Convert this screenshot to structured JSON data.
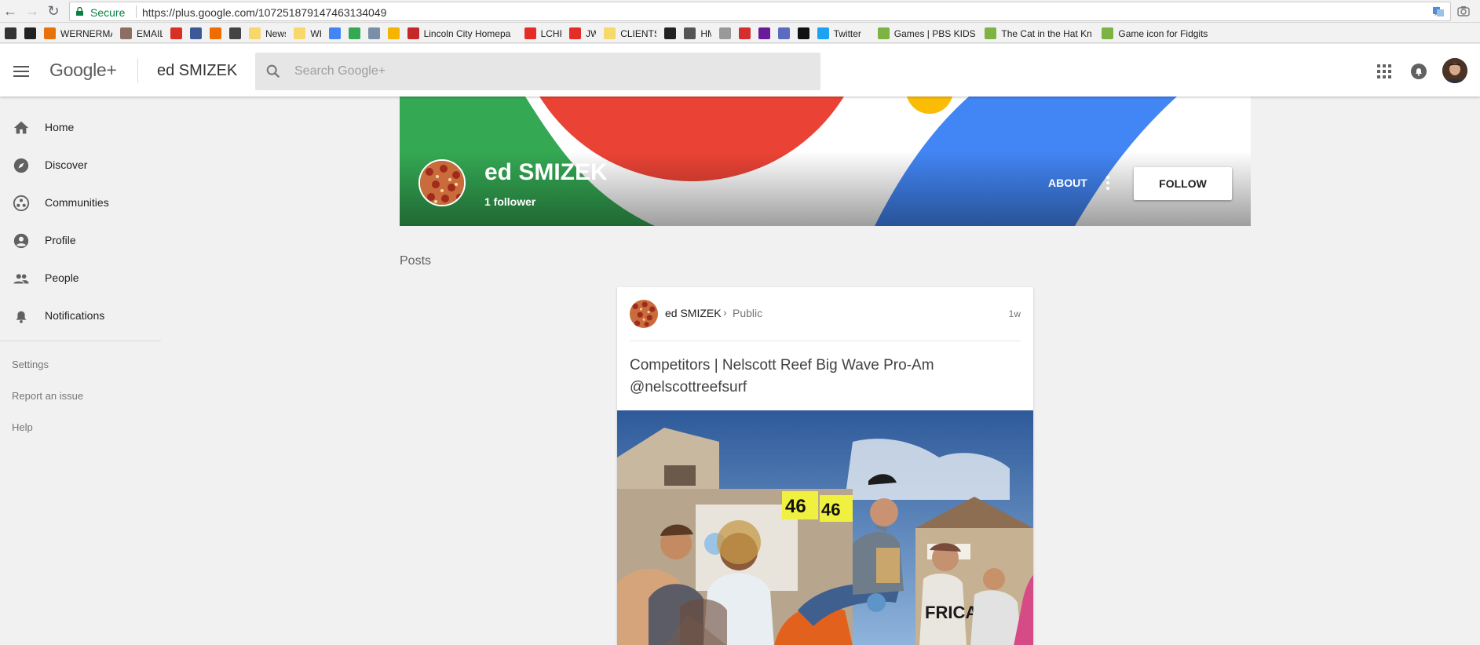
{
  "browser": {
    "secure_label": "Secure",
    "url": "https://plus.google.com/107251879147463134049",
    "bookmarks": [
      {
        "label": "",
        "color": "#333333"
      },
      {
        "label": "",
        "color": "#222222"
      },
      {
        "label": "WERNERMAIL",
        "color": "#e8710a"
      },
      {
        "label": "EMAIL",
        "color": "#8d6e63"
      },
      {
        "label": "",
        "color": "#d93025"
      },
      {
        "label": "",
        "color": "#3b5998"
      },
      {
        "label": "",
        "color": "#ef6c00"
      },
      {
        "label": "",
        "color": "#444444"
      },
      {
        "label": "News",
        "color": "#f6d86b"
      },
      {
        "label": "WH",
        "color": "#f6d86b"
      },
      {
        "label": "",
        "color": "#4285f4"
      },
      {
        "label": "",
        "color": "#34a853"
      },
      {
        "label": "",
        "color": "#7b8ea8"
      },
      {
        "label": "",
        "color": "#f4b400"
      },
      {
        "label": "Lincoln City Homepa",
        "color": "#c62828"
      },
      {
        "label": "LCHP",
        "color": "#e52d27"
      },
      {
        "label": "JW",
        "color": "#e52d27"
      },
      {
        "label": "CLIENTS",
        "color": "#f6d86b"
      },
      {
        "label": "",
        "color": "#222222"
      },
      {
        "label": "HM",
        "color": "#555555"
      },
      {
        "label": "",
        "color": "#999999"
      },
      {
        "label": "",
        "color": "#d32f2f"
      },
      {
        "label": "",
        "color": "#6a1b9a"
      },
      {
        "label": "",
        "color": "#5c6bc0"
      },
      {
        "label": "",
        "color": "#111111"
      },
      {
        "label": "Twitter",
        "color": "#1da1f2"
      },
      {
        "label": "Games | PBS KIDS",
        "color": "#7cb342"
      },
      {
        "label": "The Cat in the Hat Kn",
        "color": "#7cb342"
      },
      {
        "label": "Game icon for Fidgits",
        "color": "#7cb342"
      }
    ]
  },
  "header": {
    "logo": "Google+",
    "profile_name": "ed SMIZEK",
    "search_placeholder": "Search Google+"
  },
  "nav": {
    "items": [
      {
        "label": "Home",
        "icon": "home-icon"
      },
      {
        "label": "Discover",
        "icon": "compass-icon"
      },
      {
        "label": "Communities",
        "icon": "communities-icon"
      },
      {
        "label": "Profile",
        "icon": "account-icon"
      },
      {
        "label": "People",
        "icon": "people-icon"
      },
      {
        "label": "Notifications",
        "icon": "bell-icon"
      }
    ],
    "links": [
      "Settings",
      "Report an issue",
      "Help"
    ]
  },
  "profile": {
    "name": "ed SMIZEK",
    "followers": "1 follower",
    "about_label": "ABOUT",
    "follow_label": "FOLLOW"
  },
  "posts": {
    "section_label": "Posts",
    "items": [
      {
        "author": "ed SMIZEK",
        "visibility": "Public",
        "time": "1w",
        "text": "Competitors | Nelscott Reef Big Wave Pro-Am @nelscottreefsurf",
        "photo_numbers": [
          "46",
          "46"
        ],
        "shirt_text": "FRICA"
      }
    ]
  },
  "colors": {
    "green": "#34a853",
    "red": "#ea4335",
    "blue": "#4285f4",
    "yellow": "#fbbc05"
  }
}
